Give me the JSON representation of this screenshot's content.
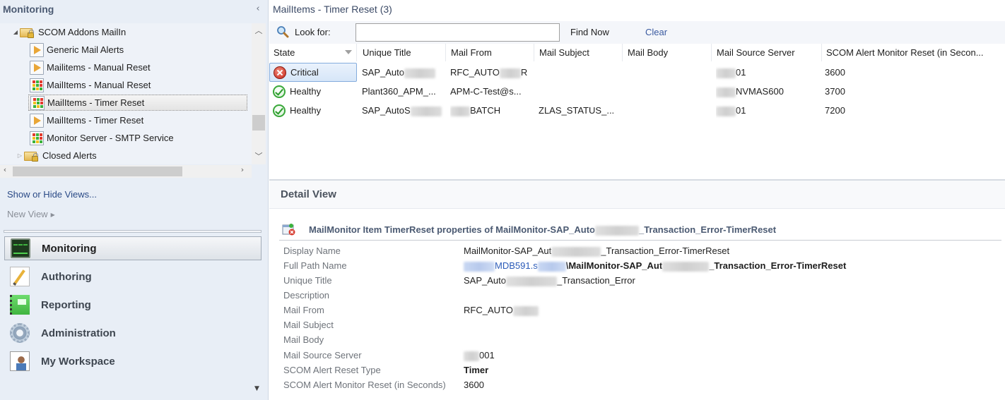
{
  "left_pane": {
    "title": "Monitoring",
    "collapse_icon": "chevron-left-icon",
    "tree": [
      {
        "label": "SCOM Addons MailIn",
        "icon": "locked-folder-icon",
        "expander": "expanded",
        "level": 0
      },
      {
        "label": "Generic Mail Alerts",
        "icon": "alert-view-icon",
        "level": 1
      },
      {
        "label": "Mailitems - Manual Reset",
        "icon": "alert-view-icon",
        "level": 1
      },
      {
        "label": "MailItems - Manual Reset",
        "icon": "state-view-icon",
        "level": 1
      },
      {
        "label": "MailItems - Timer Reset",
        "icon": "state-view-icon",
        "level": 1,
        "selected": true
      },
      {
        "label": "MailItems - Timer Reset",
        "icon": "alert-view-icon",
        "level": 1
      },
      {
        "label": "Monitor Server - SMTP Service",
        "icon": "state-view-icon",
        "level": 1
      },
      {
        "label": "Closed Alerts",
        "icon": "locked-folder-icon",
        "expander": "collapsed",
        "level": 0
      }
    ],
    "show_hide_views": "Show or Hide Views...",
    "new_view": "New View",
    "workspaces": [
      {
        "label": "Monitoring",
        "icon": "monitoring-icon",
        "active": true
      },
      {
        "label": "Authoring",
        "icon": "authoring-icon"
      },
      {
        "label": "Reporting",
        "icon": "reporting-icon"
      },
      {
        "label": "Administration",
        "icon": "administration-icon"
      },
      {
        "label": "My Workspace",
        "icon": "my-workspace-icon"
      }
    ]
  },
  "main": {
    "view_title": "MailItems - Timer Reset (3)",
    "search": {
      "label": "Look for:",
      "value": "",
      "placeholder": "",
      "find_now": "Find Now",
      "clear": "Clear"
    },
    "columns": [
      "State",
      "Unique Title",
      "Mail From",
      "Mail Subject",
      "Mail Body",
      "Mail Source Server",
      "SCOM Alert Monitor Reset (in Secon..."
    ],
    "rows": [
      {
        "state": "Critical",
        "state_icon": "critical-icon",
        "unique_title": "SAP_Auto",
        "unique_title_redacted": true,
        "mail_from_pre": "RFC_AUTO",
        "mail_from_post": "R",
        "mail_subject": "",
        "mail_body": "",
        "source_server": "01",
        "reset_seconds": "3600",
        "selected": true
      },
      {
        "state": "Healthy",
        "state_icon": "healthy-icon",
        "unique_title": "Plant360_APM_...",
        "unique_title_redacted": false,
        "mail_from_pre": "APM-C-Test@s...",
        "mail_from_post": "",
        "mail_subject": "",
        "mail_body": "",
        "source_server": "NVMAS600",
        "reset_seconds": "3700"
      },
      {
        "state": "Healthy",
        "state_icon": "healthy-icon",
        "unique_title": "SAP_AutoS",
        "unique_title_redacted": true,
        "mail_from_pre": "",
        "mail_from_post": "BATCH",
        "mail_subject": "ZLAS_STATUS_...",
        "mail_body": "",
        "source_server": "01",
        "reset_seconds": "7200"
      }
    ]
  },
  "detail": {
    "title": "Detail View",
    "props_title_pre": "MailMonitor Item TimerReset properties of MailMonitor-SAP_Auto",
    "props_title_post": "_Transaction_Error-TimerReset",
    "properties": [
      {
        "key": "Display Name",
        "pre": "MailMonitor-SAP_Aut",
        "post": "_Transaction_Error-TimerReset"
      },
      {
        "key": "Full Path Name",
        "link_pre": "MDB591.s",
        "bold_pre": "\\MailMonitor-SAP_Aut",
        "bold_post": "_Transaction_Error-TimerReset"
      },
      {
        "key": "Unique Title",
        "pre": "SAP_Auto",
        "post": "_Transaction_Error"
      },
      {
        "key": "Description",
        "value": ""
      },
      {
        "key": "Mail From",
        "pre": "RFC_AUTO",
        "post": ""
      },
      {
        "key": "Mail Subject",
        "value": ""
      },
      {
        "key": "Mail Body",
        "value": ""
      },
      {
        "key": "Mail Source Server",
        "pre": "",
        "post": "001"
      },
      {
        "key": "SCOM Alert Reset Type",
        "value": "Timer"
      },
      {
        "key": "SCOM Alert Monitor Reset (in Seconds)",
        "value": "3600"
      }
    ]
  },
  "colors": {
    "left_pane_bg": "#e8eef6",
    "link_blue": "#2a4a86",
    "critical_red": "#c8281c",
    "healthy_green": "#3aa83a",
    "selection_blue": "#84acdd"
  }
}
